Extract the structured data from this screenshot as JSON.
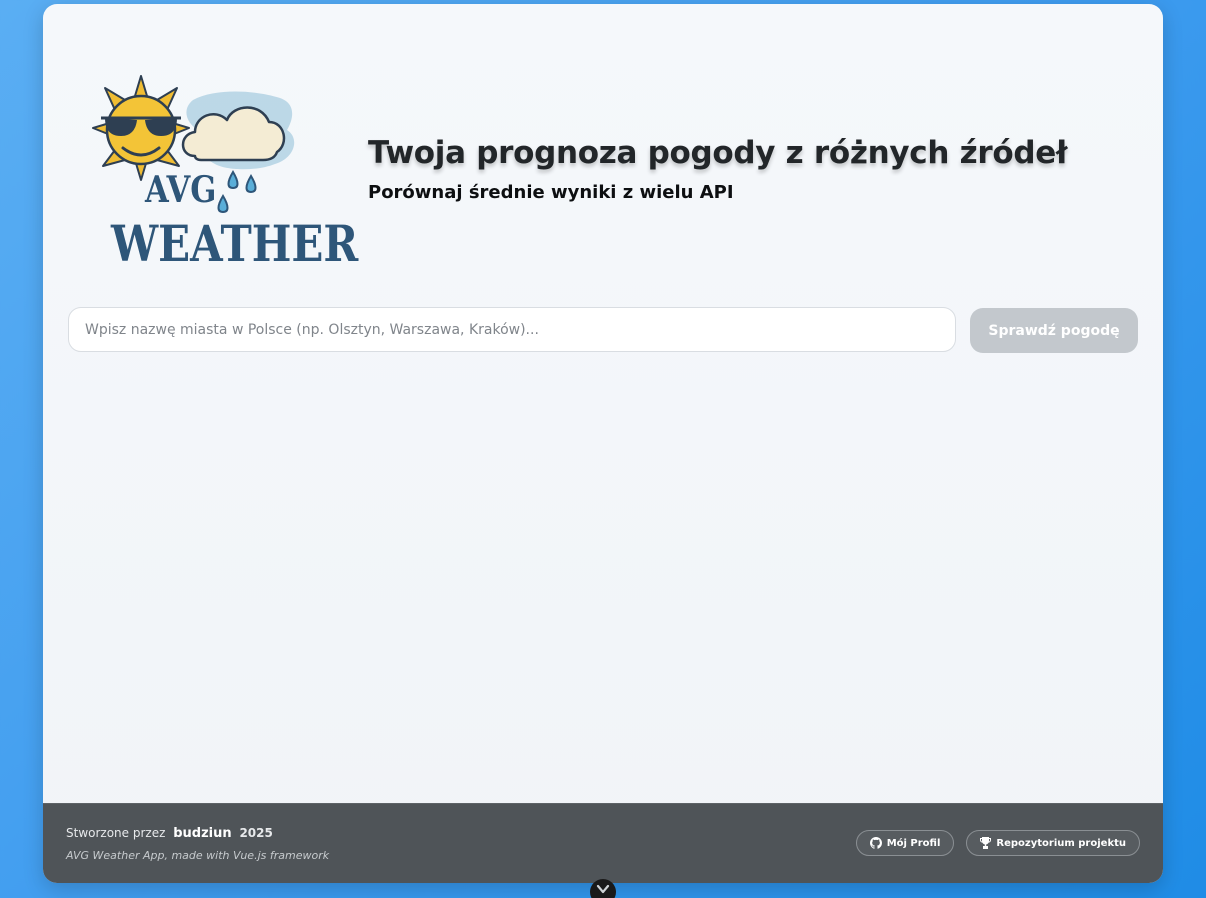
{
  "logo": {
    "line1": "AVG",
    "line2": "WEATHER"
  },
  "header": {
    "title": "Twoja prognoza pogody z różnych źródeł",
    "subtitle": "Porównaj średnie wyniki z wielu API"
  },
  "search": {
    "placeholder": "Wpisz nazwę miasta w Polsce (np. Olsztyn, Warszawa, Kraków)...",
    "value": "",
    "button_label": "Sprawdź pogodę"
  },
  "footer": {
    "created_by": "Stworzone przez",
    "author": "budziun",
    "year": "2025",
    "tagline": "AVG Weather App, made with Vue.js framework",
    "links": [
      {
        "label": "Mój Profil",
        "icon": "github-icon"
      },
      {
        "label": "Repozytorium projektu",
        "icon": "trophy-icon"
      }
    ]
  },
  "colors": {
    "background": "#3f9cef",
    "card": "#f3f6f9",
    "footer": "#4f5458",
    "button_disabled": "#c3c8cd",
    "logo_text": "#2e5679"
  }
}
